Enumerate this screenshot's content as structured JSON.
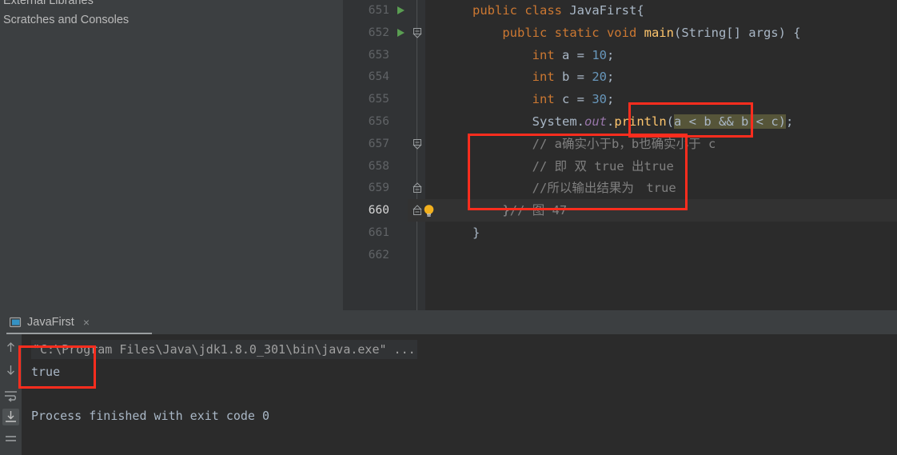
{
  "sidebar": {
    "items": [
      {
        "label": "External Libraries",
        "icon": "library-icon"
      },
      {
        "label": "Scratches and Consoles",
        "icon": "scratch-icon"
      }
    ]
  },
  "editor": {
    "lines": [
      {
        "number": "651",
        "has_run_arrow": true,
        "fold": "",
        "text": "public class JavaFirst{"
      },
      {
        "number": "652",
        "has_run_arrow": true,
        "fold": "open",
        "text": "    public static void main(String[] args) {"
      },
      {
        "number": "653",
        "has_run_arrow": false,
        "fold": "",
        "text": "        int a = 10;"
      },
      {
        "number": "654",
        "has_run_arrow": false,
        "fold": "",
        "text": "        int b = 20;"
      },
      {
        "number": "655",
        "has_run_arrow": false,
        "fold": "",
        "text": "        int c = 30;"
      },
      {
        "number": "656",
        "has_run_arrow": false,
        "fold": "",
        "text": "        System.out.println(a < b && b < c);"
      },
      {
        "number": "657",
        "has_run_arrow": false,
        "fold": "open",
        "text": "        // a确实小于b，b也确实小于 c"
      },
      {
        "number": "658",
        "has_run_arrow": false,
        "fold": "",
        "text": "        // 即 双 true 出true"
      },
      {
        "number": "659",
        "has_run_arrow": false,
        "fold": "close",
        "text": "        //所以输出结果为　true"
      },
      {
        "number": "660",
        "has_run_arrow": false,
        "fold": "close",
        "text": "    }// 图 47"
      },
      {
        "number": "661",
        "has_run_arrow": false,
        "fold": "",
        "text": "}"
      },
      {
        "number": "662",
        "has_run_arrow": false,
        "fold": "",
        "text": ""
      }
    ],
    "selection_text": "a < b && b < c)",
    "caret_line": "660",
    "comment_line_657": "// a确实小于b，b也确实小于 c",
    "comment_line_658": "// 即 双 true 出true",
    "comment_line_659": "//所以输出结果为　true",
    "line_660_text": "}// 图 47"
  },
  "run_panel": {
    "tab": {
      "label": "JavaFirst",
      "close_label": "×",
      "icon": "console-tab-icon"
    },
    "toolbar": [
      {
        "name": "scroll-up-icon",
        "selected": false
      },
      {
        "name": "scroll-down-icon",
        "selected": false
      },
      {
        "name": "soft-wrap-icon",
        "selected": false
      },
      {
        "name": "scroll-to-end-icon",
        "selected": true
      },
      {
        "name": "print-icon",
        "selected": false
      }
    ],
    "console": {
      "command_line": "\"C:\\Program Files\\Java\\jdk1.8.0_301\\bin\\java.exe\" ...",
      "output": "true",
      "exit_line": "Process finished with exit code 0"
    }
  },
  "annotations": {
    "selection_box": "highlight-around-condition",
    "comments_box": "highlight-around-comments",
    "output_box": "highlight-around-true-output",
    "color": "#fc2d1e"
  },
  "colors": {
    "editor_bg": "#2b2b2b",
    "panel_bg": "#3c3f41",
    "gutter_bg": "#313335",
    "keyword": "#cc7832",
    "number": "#6897bb",
    "method": "#ffc66d",
    "field": "#9876aa",
    "comment": "#808080",
    "text": "#a9b7c6",
    "selection": "#565539",
    "run_arrow": "#5a9e52"
  }
}
